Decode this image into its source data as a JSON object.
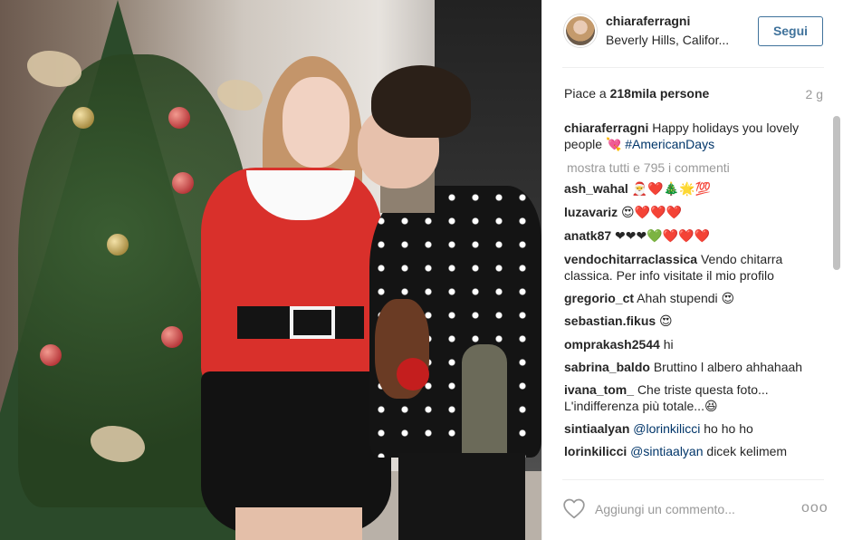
{
  "header": {
    "username": "chiaraferragni",
    "location": "Beverly Hills, Califor...",
    "follow_label": "Segui"
  },
  "likes": {
    "prefix": "Piace a ",
    "count": "218mila persone",
    "age": "2 g"
  },
  "caption": {
    "user": "chiaraferragni",
    "text": "Happy holidays you lovely people",
    "emoji": "💘",
    "hashtag": "#AmericanDays"
  },
  "load_more": "mostra tutti e 795 i commenti",
  "comments": [
    {
      "user": "ash_wahal",
      "text": "🎅❤️🎄🌟💯"
    },
    {
      "user": "luzavariz",
      "text": "😍❤️❤️❤️"
    },
    {
      "user": "anatk87",
      "text": "❤❤❤💚❤️❤️❤️"
    },
    {
      "user": "vendochitarraclassica",
      "text": "Vendo chitarra classica. Per info visitate il mio profilo"
    },
    {
      "user": "gregorio_ct",
      "text": "Ahah stupendi 😍"
    },
    {
      "user": "sebastian.fikus",
      "text": "😍"
    },
    {
      "user": "omprakash2544",
      "text": "hi"
    },
    {
      "user": "sabrina_baldo",
      "text": "Bruttino l albero ahhahaah"
    },
    {
      "user": "ivana_tom_",
      "text": "Che triste questa foto... L'indifferenza più totale...😆"
    },
    {
      "user": "sintiaalyan",
      "mention": "@lorinkilicci",
      "text": "ho ho ho"
    },
    {
      "user": "lorinkilicci",
      "mention": "@sintiaalyan",
      "text": "dicek kelimem"
    }
  ],
  "footer": {
    "comment_placeholder": "Aggiungi un commento...",
    "more_glyph": "ooo"
  },
  "icons": {
    "heart": "heart-outline-icon",
    "more": "more-options-icon"
  },
  "colors": {
    "follow_accent": "#3f729b",
    "hashtag": "#003569",
    "muted": "#999999"
  }
}
